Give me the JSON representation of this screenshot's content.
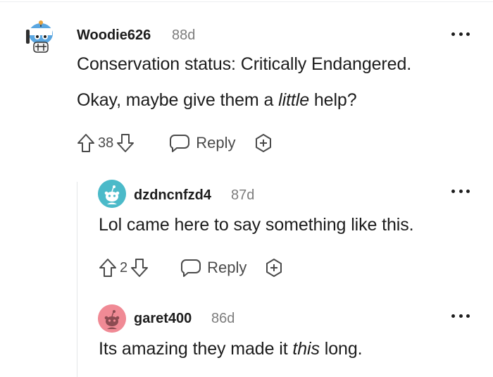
{
  "comments": [
    {
      "username": "Woodie626",
      "age": "88d",
      "paragraphs": [
        [
          {
            "text": "Conservation status: Critically Endangered."
          }
        ],
        [
          {
            "text": "Okay, maybe give them a "
          },
          {
            "text": "little",
            "italic": true
          },
          {
            "text": " help?"
          }
        ]
      ],
      "score": "38",
      "reply_label": "Reply",
      "avatar_color": "#7fb8e8"
    },
    {
      "username": "dzdncnfzd4",
      "age": "87d",
      "paragraphs": [
        [
          {
            "text": "Lol came here to say something like this."
          }
        ]
      ],
      "score": "2",
      "reply_label": "Reply",
      "avatar_color": "#4bbac9"
    },
    {
      "username": "garet400",
      "age": "86d",
      "paragraphs": [
        [
          {
            "text": "Its amazing they made it "
          },
          {
            "text": "this",
            "italic": true
          },
          {
            "text": " long."
          }
        ]
      ],
      "avatar_color": "#f08a95"
    }
  ]
}
